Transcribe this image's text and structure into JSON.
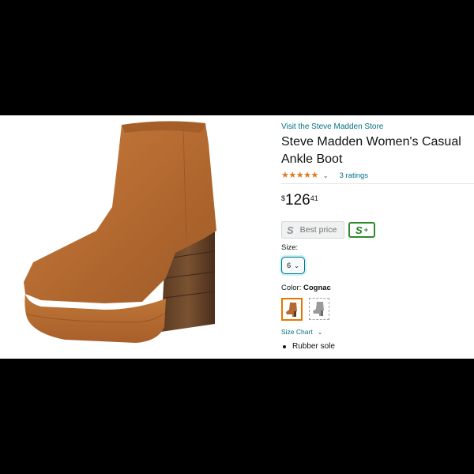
{
  "product": {
    "store_link": "Visit the Steve Madden Store",
    "title": "Steve Madden Women's Casual Ankle Boot",
    "rating_stars": 5,
    "ratings_link": "3 ratings",
    "price": {
      "symbol": "$",
      "whole": "126",
      "fraction": "41"
    },
    "best_price_letter": "S",
    "best_price_label": "Best price",
    "splus_letter": "S",
    "splus_plus": "+",
    "size_label": "Size:",
    "size_value": "6",
    "color_label": "Color:",
    "color_value": "Cognac",
    "size_chart": "Size Chart",
    "bullets": [
      "Rubber sole"
    ]
  },
  "colors": {
    "accent_link": "#007185",
    "star": "#de7921",
    "splus_green": "#2e8b2e",
    "boot_main": "#b46a30"
  },
  "icons": [
    "star-icon",
    "chevron-down-icon",
    "boot-image",
    "bullet-icon"
  ]
}
